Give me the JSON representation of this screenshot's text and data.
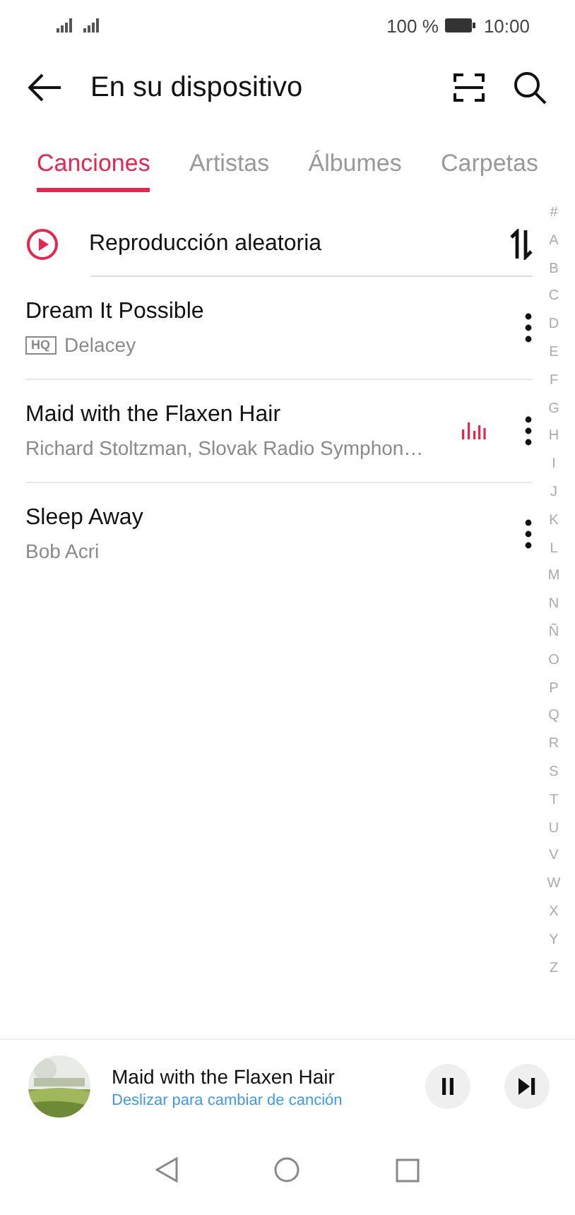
{
  "status_bar": {
    "battery": "100 %",
    "time": "10:00"
  },
  "header": {
    "title": "En su dispositivo"
  },
  "tabs": [
    {
      "label": "Canciones",
      "selected": true
    },
    {
      "label": "Artistas",
      "selected": false
    },
    {
      "label": "Álbumes",
      "selected": false
    },
    {
      "label": "Carpetas",
      "selected": false
    }
  ],
  "shuffle": {
    "label": "Reproducción aleatoria"
  },
  "songs": [
    {
      "title": "Dream It Possible",
      "artist": "Delacey",
      "badge": "HQ",
      "playing": false
    },
    {
      "title": "Maid with the Flaxen Hair",
      "artist": "Richard Stoltzman, Slovak Radio Symphon…",
      "playing": true
    },
    {
      "title": "Sleep Away",
      "artist": "Bob Acri",
      "playing": false
    }
  ],
  "index": [
    "#",
    "A",
    "B",
    "C",
    "D",
    "E",
    "F",
    "G",
    "H",
    "I",
    "J",
    "K",
    "L",
    "M",
    "N",
    "Ñ",
    "O",
    "P",
    "Q",
    "R",
    "S",
    "T",
    "U",
    "V",
    "W",
    "X",
    "Y",
    "Z"
  ],
  "player": {
    "title": "Maid with the Flaxen Hair",
    "hint": "Deslizar para cambiar de canción"
  }
}
